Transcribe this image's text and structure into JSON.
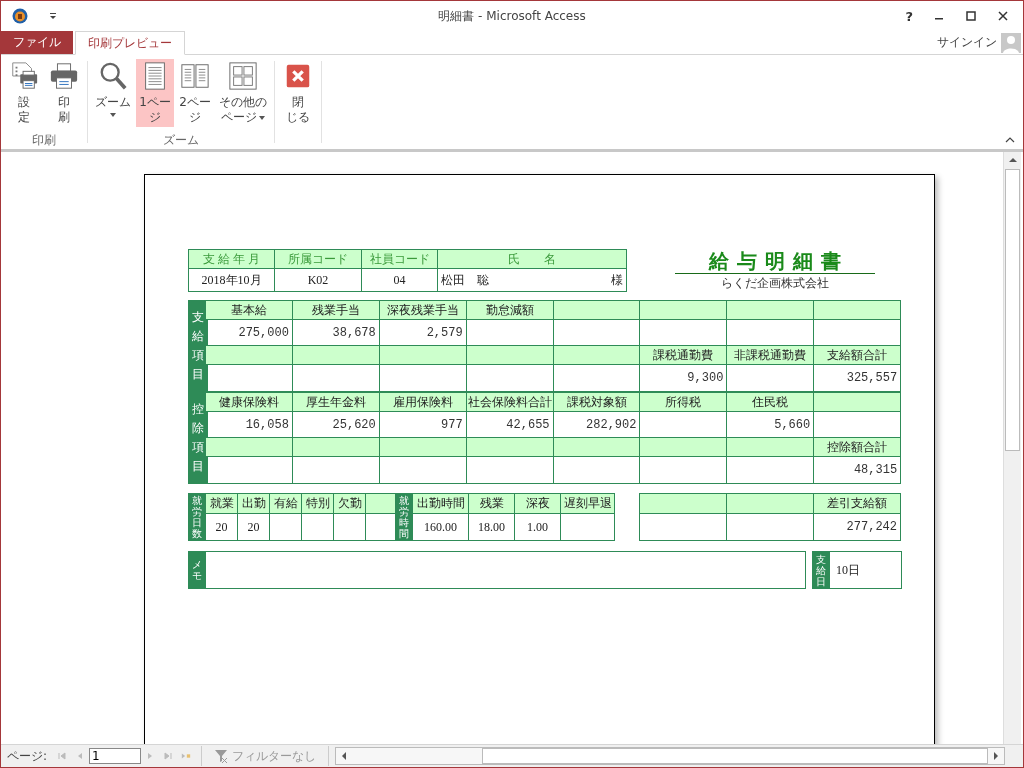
{
  "window": {
    "title": "明細書 - Microsoft Access",
    "help": "?",
    "account": "サインイン"
  },
  "ribbon_tabs": [
    {
      "label": "ファイル",
      "kind": "file",
      "selected": false
    },
    {
      "label": "印刷プレビュー",
      "kind": "tab",
      "selected": true
    }
  ],
  "ribbon_groups": [
    {
      "label": "印刷",
      "buttons": [
        {
          "lines": [
            "設",
            "定"
          ],
          "kind": "setup",
          "selected": false,
          "dropdown": false
        },
        {
          "lines": [
            "印",
            "刷"
          ],
          "kind": "print",
          "selected": false,
          "dropdown": false
        }
      ]
    },
    {
      "label": "ズーム",
      "buttons": [
        {
          "lines": [
            "ズーム"
          ],
          "kind": "zoom",
          "selected": false,
          "dropdown": true
        },
        {
          "lines": [
            "1ペー",
            "ジ"
          ],
          "kind": "one",
          "selected": true,
          "dropdown": false
        },
        {
          "lines": [
            "2ペー",
            "ジ"
          ],
          "kind": "two",
          "selected": false,
          "dropdown": false
        },
        {
          "lines": [
            "その他の",
            "ページ"
          ],
          "kind": "more",
          "selected": false,
          "dropdown": true
        }
      ]
    },
    {
      "buttons": [
        {
          "lines": [
            "閉",
            "じる"
          ],
          "kind": "close",
          "selected": false,
          "dropdown": false
        }
      ]
    }
  ],
  "report": {
    "title": "給与明細書",
    "company": "らくだ企画株式会社",
    "info": {
      "headers": [
        "支 給 年 月",
        "所属コード",
        "社員コード",
        "氏　　名"
      ],
      "values": [
        "2018年10月",
        "K02",
        "04"
      ],
      "name": "松田　聡",
      "honorific": "様"
    },
    "sections": [
      {
        "label": "支給項目",
        "rows": [
          {
            "kind": "header",
            "cells": [
              "基本給",
              "残業手当",
              "深夜残業手当",
              "勤怠減額",
              null,
              null,
              null,
              null
            ]
          },
          {
            "kind": "value",
            "cells": [
              "275,000",
              "38,678",
              "2,579",
              null,
              null,
              null,
              null,
              null
            ]
          },
          {
            "kind": "header",
            "cells": [
              null,
              null,
              null,
              null,
              null,
              "課税通勤費",
              "非課税通勤費",
              "支給額合計"
            ]
          },
          {
            "kind": "value",
            "cells": [
              null,
              null,
              null,
              null,
              null,
              "9,300",
              null,
              "325,557"
            ]
          }
        ]
      },
      {
        "label": "控除項目",
        "rows": [
          {
            "kind": "header",
            "cells": [
              "健康保険料",
              "厚生年金料",
              "雇用保険料",
              "社会保険料合計",
              "課税対象額",
              "所得税",
              "住民税",
              null
            ]
          },
          {
            "kind": "value",
            "cells": [
              "16,058",
              "25,620",
              "977",
              "42,655",
              "282,902",
              null,
              "5,660",
              null
            ]
          },
          {
            "kind": "header",
            "cells": [
              null,
              null,
              null,
              null,
              null,
              null,
              null,
              "控除額合計"
            ]
          },
          {
            "kind": "value",
            "cells": [
              null,
              null,
              null,
              null,
              null,
              null,
              null,
              "48,315"
            ]
          }
        ]
      }
    ],
    "days": {
      "label": "就労日数",
      "headers": [
        "就業",
        "出勤",
        "有給",
        "特別",
        "欠勤"
      ],
      "values": [
        "20",
        "20"
      ]
    },
    "hours": {
      "label": "就労時間",
      "headers": [
        "出勤時間",
        "残業",
        "深夜",
        "遅刻早退"
      ],
      "values": [
        "160.00",
        "18.00",
        "1.00"
      ]
    },
    "net": {
      "headers": [
        "差引支給額"
      ],
      "values": [
        "277,242"
      ]
    },
    "memo": {
      "label": "メモ"
    },
    "pay_date": {
      "label": "支給日",
      "value": "10日"
    }
  },
  "status_bar": {
    "page_label": "ページ:",
    "page": "1",
    "filter": "フィルターなし"
  }
}
